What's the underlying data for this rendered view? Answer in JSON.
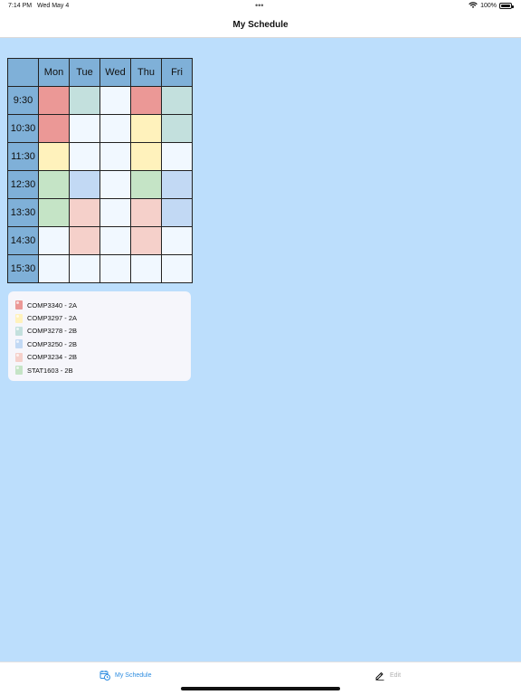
{
  "status_bar": {
    "time": "7:14 PM",
    "date": "Wed May 4",
    "battery": "100%"
  },
  "nav": {
    "title": "My Schedule"
  },
  "schedule": {
    "days": [
      "Mon",
      "Tue",
      "Wed",
      "Thu",
      "Fri"
    ],
    "times": [
      "9:30",
      "10:30",
      "11:30",
      "12:30",
      "13:30",
      "14:30",
      "15:30"
    ],
    "cells": [
      [
        "red",
        "teal",
        "empty",
        "red",
        "teal"
      ],
      [
        "red",
        "empty",
        "empty",
        "yellow",
        "teal"
      ],
      [
        "yellow",
        "empty",
        "empty",
        "yellow",
        "empty"
      ],
      [
        "green",
        "blue",
        "empty",
        "green",
        "blue"
      ],
      [
        "green",
        "pink",
        "empty",
        "pink",
        "blue"
      ],
      [
        "empty",
        "pink",
        "empty",
        "pink",
        "empty"
      ],
      [
        "empty",
        "empty",
        "empty",
        "empty",
        "empty"
      ]
    ]
  },
  "legend": [
    {
      "label": "COMP3340 - 2A",
      "color": "#eb9896"
    },
    {
      "label": "COMP3297 - 2A",
      "color": "#fff2bc"
    },
    {
      "label": "COMP3278 - 2B",
      "color": "#c3e0dd"
    },
    {
      "label": "COMP3250 - 2B",
      "color": "#c2d9f4"
    },
    {
      "label": "COMP3234 - 2B",
      "color": "#f5d0ca"
    },
    {
      "label": "STAT1603 - 2B",
      "color": "#c5e4c6"
    }
  ],
  "tabs": {
    "schedule": {
      "label": "My Schedule",
      "icon": "calendar-clock-icon",
      "color": "#2e8de0"
    },
    "edit": {
      "label": "Edit",
      "icon": "pencil-icon",
      "color": "#b0b0b0"
    }
  },
  "colors": {
    "background": "#bcdefc",
    "header_cell": "#7fb0d8",
    "empty_cell": "#f1f8ff"
  }
}
